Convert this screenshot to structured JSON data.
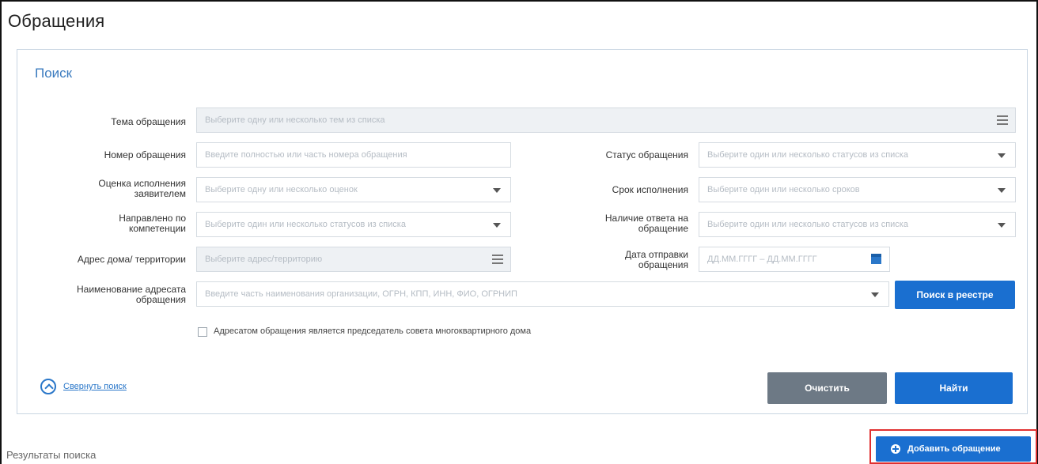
{
  "page": {
    "title": "Обращения"
  },
  "search": {
    "title": "Поиск",
    "fields": {
      "subject": {
        "label": "Тема обращения",
        "placeholder": "Выберите одну или несколько тем из списка"
      },
      "number": {
        "label": "Номер обращения",
        "placeholder": "Введите полностью или часть номера обращения"
      },
      "status": {
        "label": "Статус обращения",
        "placeholder": "Выберите один или несколько статусов из списка"
      },
      "rating": {
        "label": "Оценка исполнения заявителем",
        "placeholder": "Выберите одну или несколько оценок"
      },
      "term": {
        "label": "Срок исполнения",
        "placeholder": "Выберите один или несколько сроков"
      },
      "competence": {
        "label": "Направлено по компетенции",
        "placeholder": "Выберите один или несколько статусов из списка"
      },
      "answer": {
        "label": "Наличие ответа на обращение",
        "placeholder": "Выберите один или несколько статусов из списка"
      },
      "address": {
        "label": "Адрес дома/ территории",
        "placeholder": "Выберите адрес/территорию"
      },
      "send_date": {
        "label": "Дата отправки обращения",
        "placeholder": "ДД.ММ.ГГГГ – ДД.ММ.ГГГГ"
      },
      "addressee": {
        "label": "Наименование адресата обращения",
        "placeholder": "Введите часть наименования организации, ОГРН, КПП, ИНН, ФИО, ОГРНИП"
      }
    },
    "registry_button": "Поиск в реестре",
    "checkbox_label": "Адресатом обращения является председатель совета многоквартирного дома",
    "collapse_link": "Свернуть поиск",
    "clear_button": "Очистить",
    "find_button": "Найти"
  },
  "results": {
    "label": "Результаты поиска"
  },
  "add_button": "Добавить обращение",
  "icons": {
    "dropdown": "chevron-down-icon",
    "list": "list-icon",
    "calendar": "calendar-icon",
    "collapse": "collapse-up-icon",
    "add": "plus-circle-icon"
  },
  "colors": {
    "accent": "#1a6fd0",
    "title_blue": "#3b7bbf",
    "highlight_border": "#e03030"
  }
}
